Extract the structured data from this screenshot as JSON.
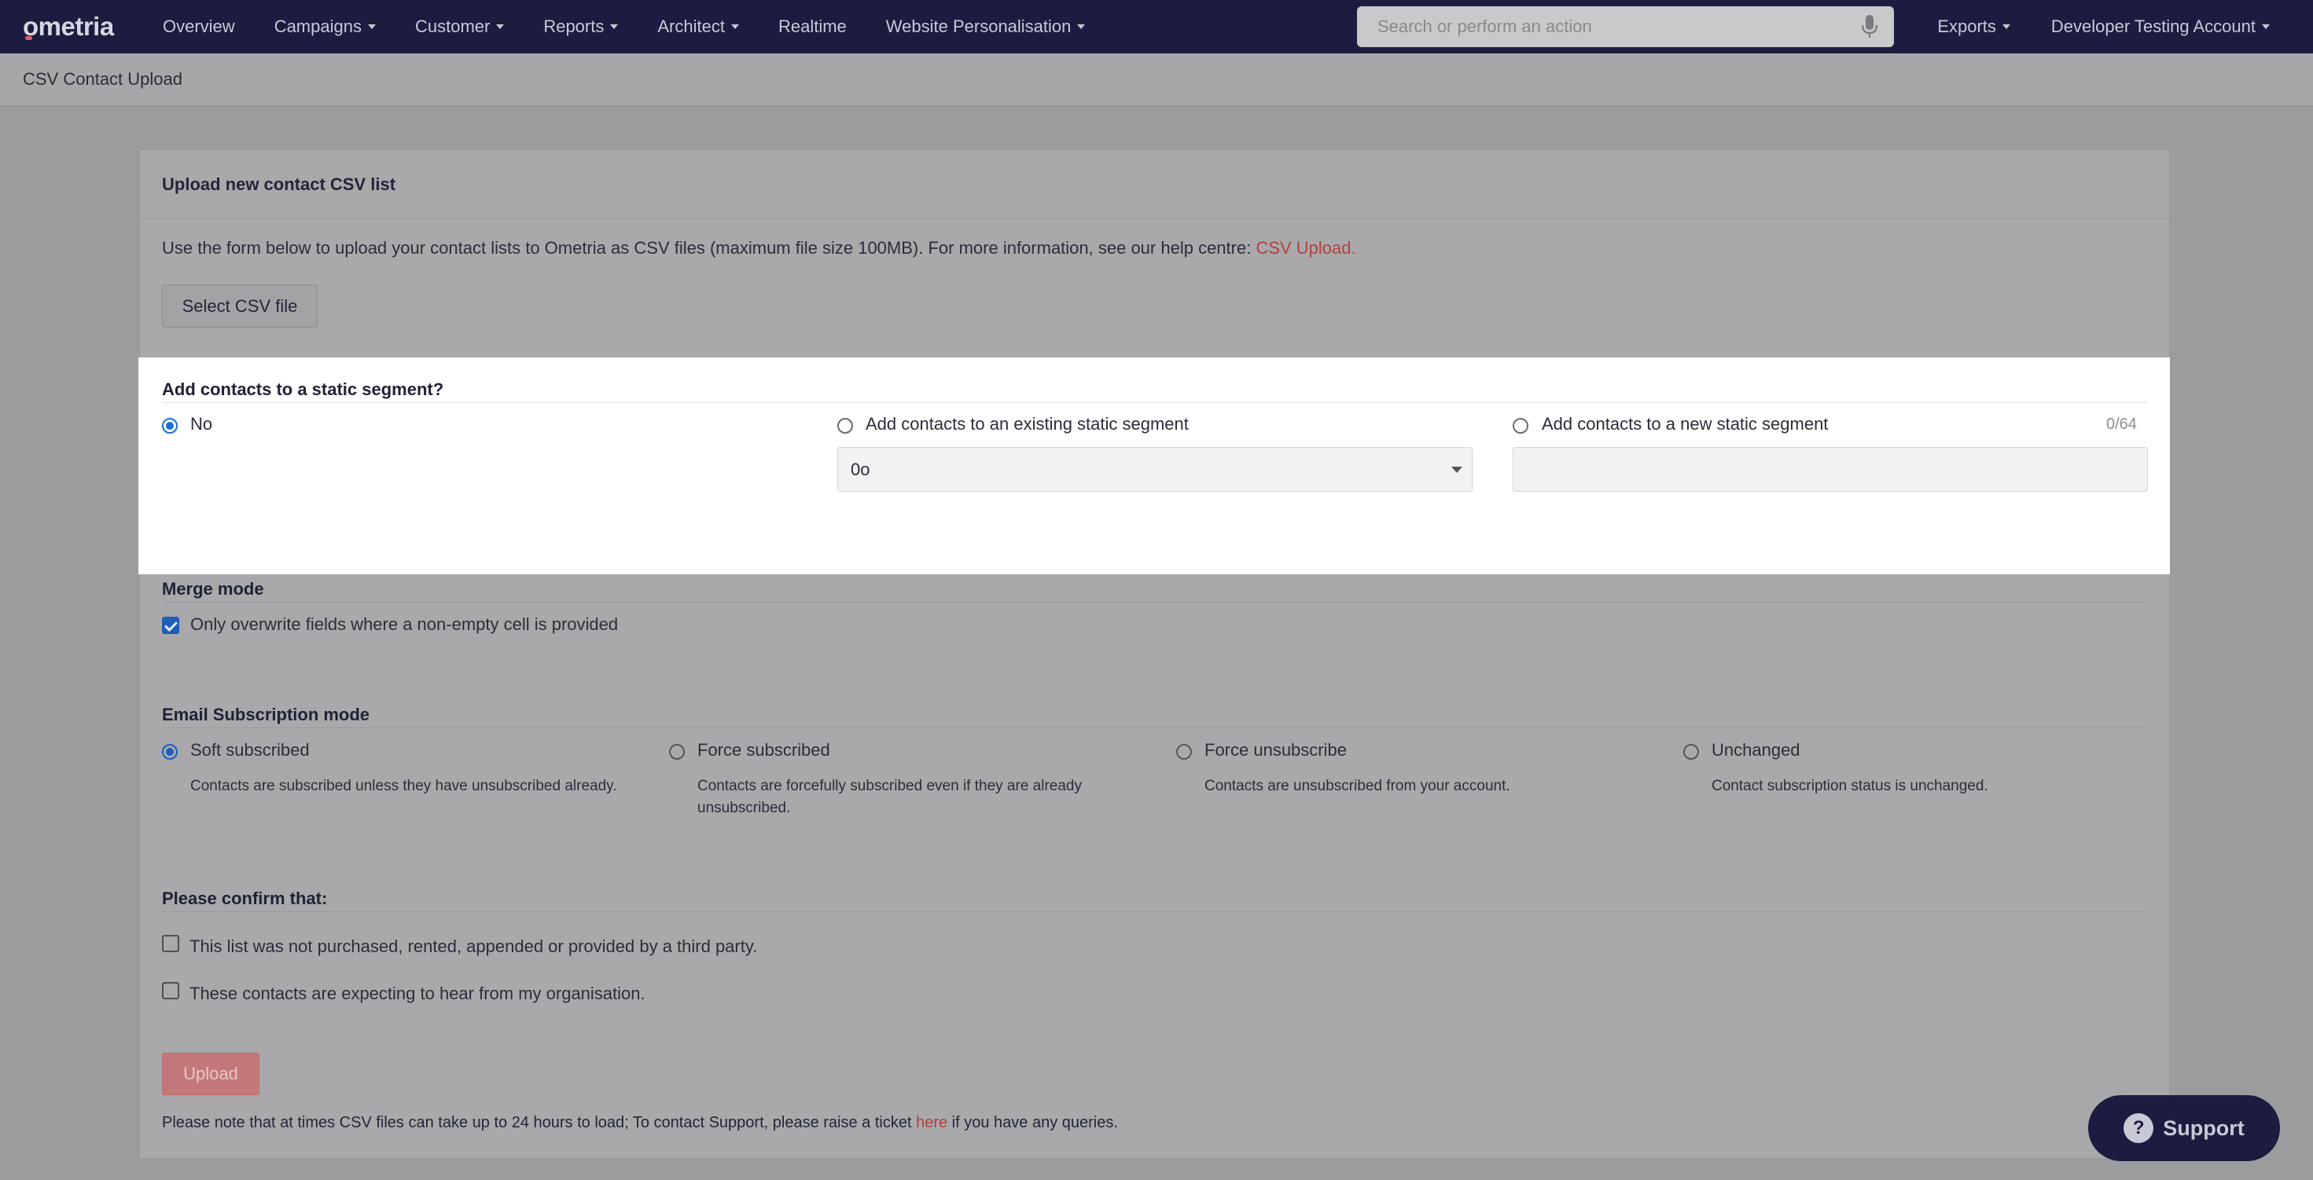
{
  "nav": {
    "logo": "ometria",
    "items": [
      {
        "label": "Overview",
        "dropdown": false
      },
      {
        "label": "Campaigns",
        "dropdown": true
      },
      {
        "label": "Customer",
        "dropdown": true
      },
      {
        "label": "Reports",
        "dropdown": true
      },
      {
        "label": "Architect",
        "dropdown": true
      },
      {
        "label": "Realtime",
        "dropdown": false
      },
      {
        "label": "Website Personalisation",
        "dropdown": true
      }
    ],
    "search_placeholder": "Search or perform an action",
    "exports": "Exports",
    "account": "Developer Testing Account"
  },
  "page_title": "CSV Contact Upload",
  "card": {
    "title": "Upload new contact CSV list",
    "intro": "Use the form below to upload your contact lists to Ometria as CSV files (maximum file size 100MB). For more information, see our help centre: ",
    "intro_link": "CSV Upload.",
    "select_button": "Select CSV file"
  },
  "segment": {
    "title": "Add contacts to a static segment?",
    "option_no": "No",
    "option_existing": "Add contacts to an existing static segment",
    "option_new": "Add contacts to a new static segment",
    "counter": "0/64",
    "selected_segment": "0o"
  },
  "merge": {
    "title": "Merge mode",
    "option": "Only overwrite fields where a non-empty cell is provided"
  },
  "subscription": {
    "title": "Email Subscription mode",
    "options": [
      {
        "label": "Soft subscribed",
        "desc": "Contacts are subscribed unless they have unsubscribed already."
      },
      {
        "label": "Force subscribed",
        "desc": "Contacts are forcefully subscribed even if they are already unsubscribed."
      },
      {
        "label": "Force unsubscribe",
        "desc": "Contacts are unsubscribed from your account."
      },
      {
        "label": "Unchanged",
        "desc": "Contact subscription status is unchanged."
      }
    ]
  },
  "confirm": {
    "title": "Please confirm that:",
    "item1": "This list was not purchased, rented, appended or provided by a third party.",
    "item2": "These contacts are expecting to hear from my organisation."
  },
  "upload_button": "Upload",
  "note": {
    "before": "Please note that at times CSV files can take up to 24 hours to load; To contact Support, please raise a ticket ",
    "link": "here",
    "after": " if you have any queries."
  },
  "support": "Support"
}
